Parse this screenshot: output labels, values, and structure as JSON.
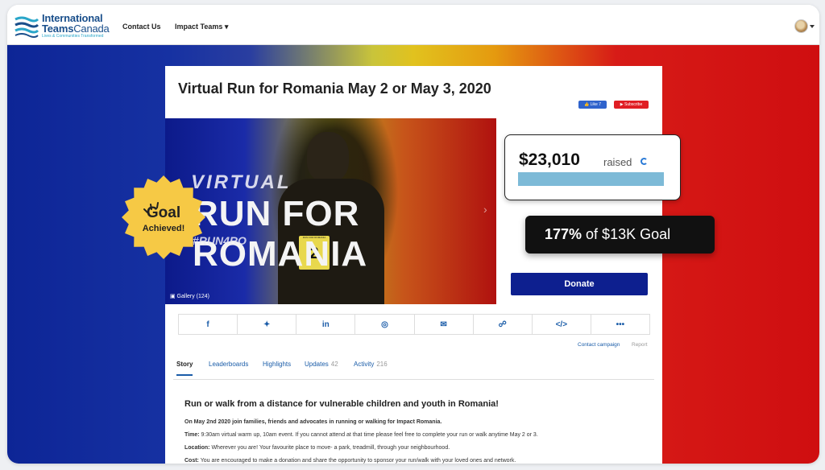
{
  "brand": {
    "line1": "International",
    "line2a": "Teams",
    "line2b": "Canada",
    "tagline": "Lives & Communities Transformed"
  },
  "nav": {
    "contact": "Contact Us",
    "impact_teams": "Impact Teams ▾"
  },
  "campaign": {
    "title": "Virtual Run for Romania May 2 or May 3, 2020",
    "fb_like": "👍 Like 7",
    "yt_subscribe": "▶ Subscribe",
    "hero_virtual": "VIRTUAL",
    "hero_run": "RUN FOR ROMANIA",
    "hero_tag": "#RUN4RO",
    "bib_number": "2",
    "bib_header": "RUN FOR ROMANIA",
    "gallery": "▣ Gallery (124)",
    "donate": "Donate",
    "contact_campaign": "Contact campaign",
    "report": "Report"
  },
  "share_icons": [
    "f",
    "✦",
    "in",
    "◎",
    "✉",
    "☍",
    "</>",
    "•••"
  ],
  "tabs": [
    {
      "label": "Story",
      "count": ""
    },
    {
      "label": "Leaderboards",
      "count": ""
    },
    {
      "label": "Highlights",
      "count": ""
    },
    {
      "label": "Updates",
      "count": "42"
    },
    {
      "label": "Activity",
      "count": "216"
    }
  ],
  "story": {
    "heading": "Run or walk from a distance for vulnerable children and youth in Romania!",
    "p1": "On May 2nd 2020 join families, friends and advocates in running or walking for Impact Romania.",
    "time_label": "Time:",
    "time_text": " 9:30am virtual warm up, 10am event.  If you cannot attend at that time please feel free to complete your run or walk anytime May 2 or 3.",
    "location_label": "Location:",
    "location_text": "  Wherever you are!  Your favourite place to move- a park, treadmill, through your neighbourhood.",
    "cost_label": "Cost:",
    "cost_text": " You are encouraged to make a donation and share the opportunity to sponsor your run/walk with your loved ones and network."
  },
  "raised": {
    "amount": "$23,010",
    "label": "raised",
    "progress_fraction": 1.0
  },
  "goal": {
    "percent": "177%",
    "of_text": " of $13K Goal"
  },
  "badge": {
    "line1": "Goal",
    "line2": "Achieved!"
  },
  "colors": {
    "donate": "#0d1f8f",
    "link": "#1a5ca8",
    "badge": "#f6c945",
    "progress": "#7dbad7"
  }
}
